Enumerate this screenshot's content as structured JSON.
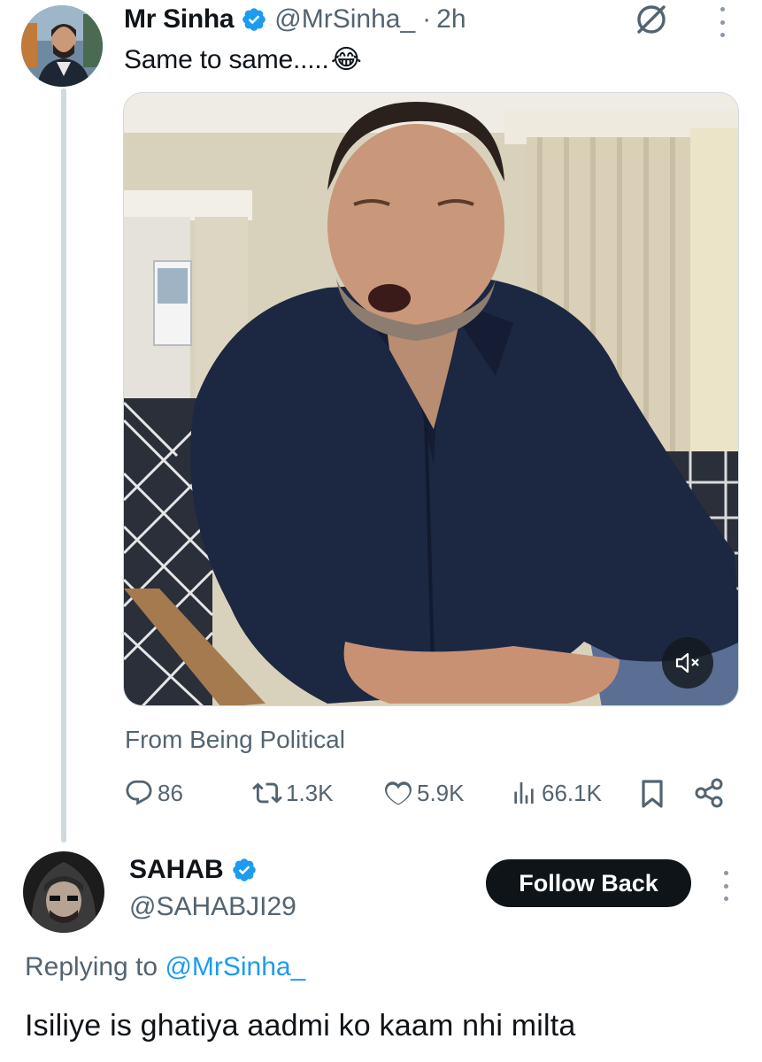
{
  "colors": {
    "verified": "#1d9bf0",
    "link": "#1d9bf0",
    "muted_text": "#536471",
    "primary_text": "#0f1419",
    "follow_button_bg": "#0f1419",
    "follow_button_text": "#ffffff"
  },
  "tweet": {
    "author": {
      "name": "Mr Sinha",
      "handle": "@MrSinha_",
      "verified": true,
      "avatar_icon": "avatar-photo"
    },
    "separator": "·",
    "time": "2h",
    "text": "Same to same.....",
    "emoji": "😂",
    "icons": [
      "grok-icon",
      "more-options-icon"
    ],
    "media": {
      "type": "video",
      "muted": true,
      "mute_icon": "speaker-muted-icon"
    },
    "source": "From Being Political",
    "stats": {
      "replies": "86",
      "retweets": "1.3K",
      "likes": "5.9K",
      "views": "66.1K"
    },
    "action_icons": [
      "reply-icon",
      "retweet-icon",
      "like-icon",
      "views-icon",
      "bookmark-icon",
      "share-icon"
    ]
  },
  "reply": {
    "author": {
      "name": "SAHAB",
      "handle": "@SAHABJI29",
      "verified": true,
      "avatar_icon": "avatar-photo"
    },
    "follow_button_label": "Follow Back",
    "replying_prefix": "Replying to",
    "replying_to": "@MrSinha_",
    "text": "Isiliye is ghatiya aadmi ko kaam nhi milta"
  }
}
